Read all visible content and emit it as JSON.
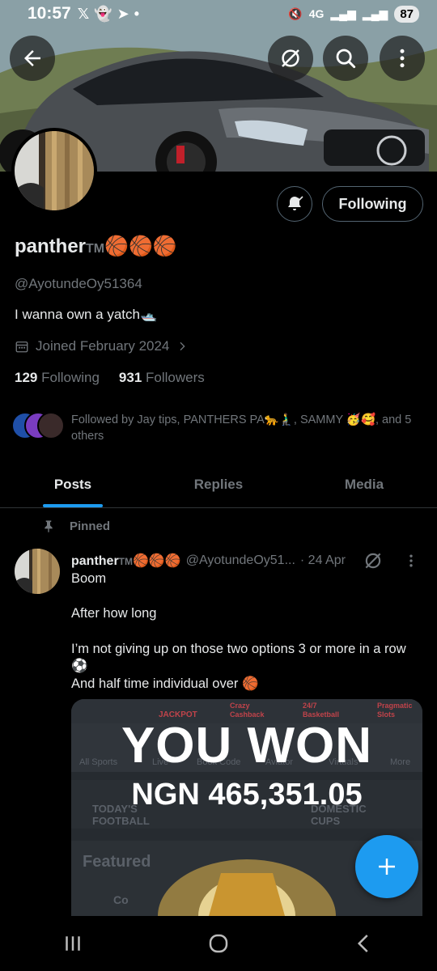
{
  "status_bar": {
    "time": "10:57",
    "network": "4G",
    "battery": "87"
  },
  "profile": {
    "display_name": "panther",
    "tm": "TM",
    "name_emoji": "🏀🏀🏀",
    "handle": "@AyotundeOy51364",
    "bio": "I wanna own a yatch🛥️",
    "joined": "Joined February 2024",
    "following_count": "129",
    "following_label": "Following",
    "followers_count": "931",
    "followers_label": "Followers",
    "follow_button_label": "Following",
    "followed_by": "Followed by Jay tips, PANTHERS PA🐆🧎‍♂️, SAMMY 🥳🥰, and 5 others"
  },
  "tabs": [
    {
      "label": "Posts",
      "active": true
    },
    {
      "label": "Replies",
      "active": false
    },
    {
      "label": "Media",
      "active": false
    }
  ],
  "post": {
    "pinned_label": "Pinned",
    "author_name": "panther",
    "author_tm": "TM",
    "author_emoji": "🏀🏀🏀",
    "author_handle": "@AyotundeOy51...",
    "date": "· 24 Apr",
    "lines": [
      "Boom",
      "After how long",
      "I’m not giving up on those two options 3 or more in a row",
      "⚽",
      "And half time individual over 🏀"
    ],
    "media": {
      "headline": "YOU WON",
      "amount": "NGN 465,351.05",
      "bg_labels": [
        "JACKPOT",
        "Crazy Cashback",
        "24/7 Basketball",
        "Pragmatic Slots",
        "All Sports",
        "Live",
        "Book Code",
        "Aviator",
        "Virtuals",
        "More",
        "TODAY'S FOOTBALL",
        "DOMESTIC CUPS",
        "Featured",
        "Co"
      ]
    }
  },
  "colors": {
    "accent": "#1d9bf0",
    "text_primary": "#e7e9ea",
    "text_secondary": "#71767b",
    "background": "#000000"
  }
}
